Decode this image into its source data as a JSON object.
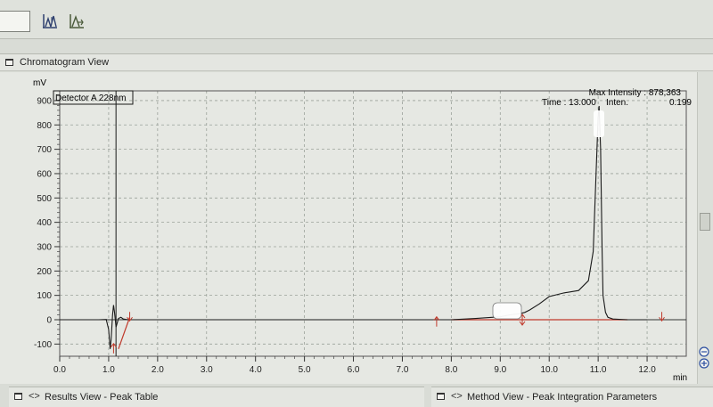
{
  "toolbar": {
    "input_value": "",
    "buttons": [
      {
        "icon": "peak-integration-icon"
      },
      {
        "icon": "peak-adjust-icon"
      }
    ]
  },
  "panel": {
    "title": "Chromatogram View"
  },
  "chart_data": {
    "type": "line",
    "ylabel": "mV",
    "xlabel": "min",
    "xlim": [
      0.0,
      12.8
    ],
    "ylim": [
      -150,
      940
    ],
    "x_ticks": [
      "0.0",
      "1.0",
      "2.0",
      "3.0",
      "4.0",
      "5.0",
      "6.0",
      "7.0",
      "8.0",
      "9.0",
      "10.0",
      "11.0",
      "12.0"
    ],
    "y_ticks": [
      "-100",
      "0",
      "100",
      "200",
      "300",
      "400",
      "500",
      "600",
      "700",
      "800",
      "900"
    ],
    "grid": true,
    "detector_label": "Detector A 228nm",
    "max_intensity_text": "Max Intensity : 878,363",
    "cursor_time_text": "Time : 13.000",
    "cursor_inten_label": "Inten.",
    "cursor_inten_value": "0.199",
    "series": [
      {
        "color": "#1a1a1a",
        "x": [
          0.0,
          0.8,
          0.95,
          1.0,
          1.03,
          1.05,
          1.08,
          1.1,
          1.12,
          1.15,
          1.18,
          1.2,
          1.25,
          1.3,
          1.4,
          1.6,
          2.0,
          4.0,
          7.0,
          8.0,
          8.5,
          9.0,
          9.2,
          9.4,
          9.5,
          9.6,
          9.8,
          10.0,
          10.3,
          10.6,
          10.8,
          10.9,
          10.95,
          11.0,
          11.02,
          11.05,
          11.08,
          11.1,
          11.15,
          11.2,
          11.3,
          11.6,
          12.0
        ],
        "y": [
          0,
          0,
          1,
          -40,
          -120,
          -80,
          20,
          60,
          30,
          -30,
          -10,
          5,
          10,
          3,
          0,
          0,
          0,
          0,
          0,
          0,
          5,
          12,
          20,
          25,
          30,
          40,
          65,
          95,
          110,
          120,
          160,
          280,
          560,
          830,
          878,
          700,
          300,
          100,
          30,
          10,
          3,
          0,
          0
        ]
      }
    ],
    "baselines": [
      {
        "color": "#c0392b",
        "x": [
          1.2,
          1.43
        ],
        "y": [
          -120,
          10
        ]
      },
      {
        "color": "#c0392b",
        "x": [
          8.0,
          11.6
        ],
        "y": [
          0,
          0
        ]
      }
    ],
    "integration_markers": [
      {
        "color": "#c0392b",
        "x": 1.1,
        "y": -120,
        "kind": "up"
      },
      {
        "color": "#c0392b",
        "x": 1.43,
        "y": 10,
        "kind": "down"
      },
      {
        "color": "#c0392b",
        "x": 7.7,
        "y": -10,
        "kind": "up"
      },
      {
        "color": "#c0392b",
        "x": 9.45,
        "y": 0,
        "kind": "split"
      },
      {
        "color": "#c0392b",
        "x": 12.3,
        "y": 10,
        "kind": "down"
      }
    ],
    "cursor_line_x": 1.15
  },
  "bottom_left": {
    "arrows": "<>",
    "label": "Results View - Peak Table"
  },
  "bottom_right": {
    "arrows": "<>",
    "label": "Method View - Peak Integration Parameters"
  },
  "colors": {
    "chart_bg": "#e6e8e3",
    "grid": "#9aa19a",
    "trace": "#1a1a1a",
    "baseline": "#c0392b"
  }
}
